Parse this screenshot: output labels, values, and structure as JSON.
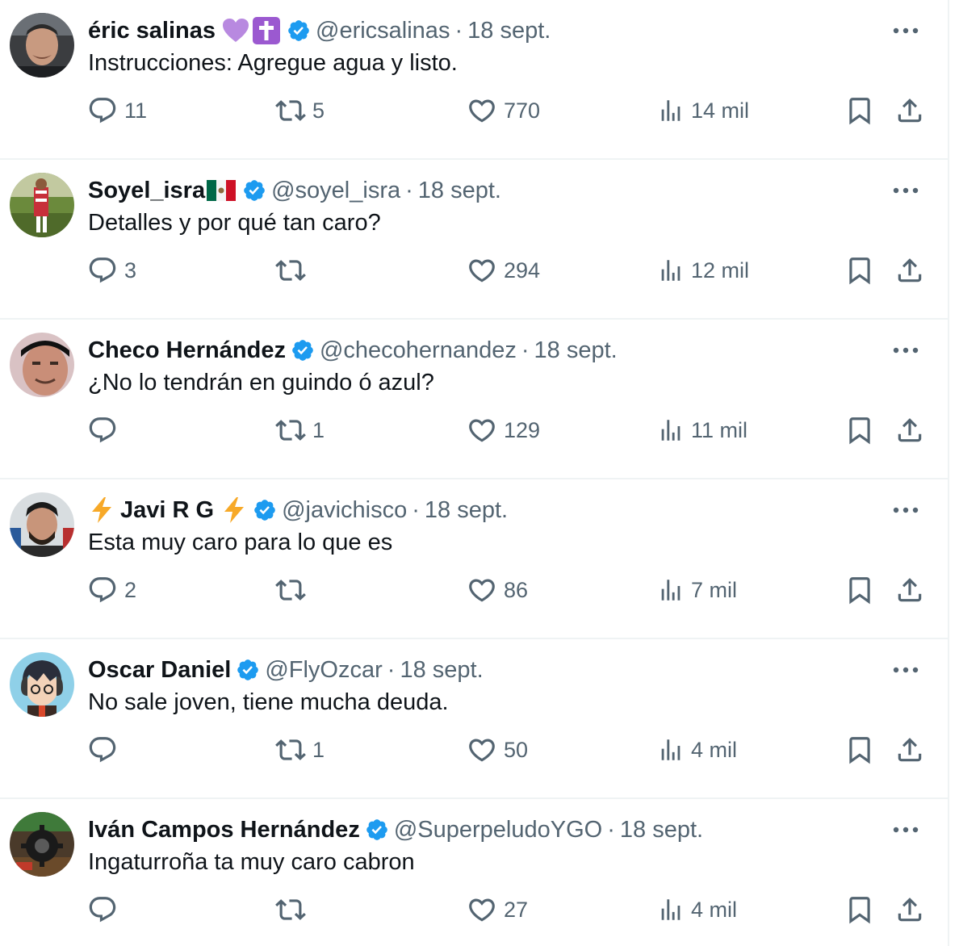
{
  "colors": {
    "text": "#0f1419",
    "secondary": "#536471",
    "verified": "#1d9bf0",
    "divider": "#eff3f4"
  },
  "tweets": [
    {
      "name": "éric salinas",
      "name_emojis": [
        "purple-heart-icon",
        "latin-cross-icon"
      ],
      "handle": "@ericsalinas",
      "separator": "·",
      "date": "18 sept.",
      "text": "Instrucciones: Agregue agua y listo.",
      "replies": "11",
      "retweets": "5",
      "likes": "770",
      "views": "14 mil"
    },
    {
      "name": "Soyel_isra",
      "name_emojis": [
        "mexico-flag-icon"
      ],
      "handle": "@soyel_isra",
      "separator": "·",
      "date": "18 sept.",
      "text": "Detalles y por qué tan caro?",
      "replies": "3",
      "retweets": "",
      "likes": "294",
      "views": "12 mil"
    },
    {
      "name": "Checo Hernández",
      "name_emojis": [],
      "handle": "@checohernandez",
      "separator": "·",
      "date": "18 sept.",
      "text": "¿No lo tendrán en guindo ó azul?",
      "replies": "",
      "retweets": "1",
      "likes": "129",
      "views": "11 mil"
    },
    {
      "name": "Javi R G",
      "name_emojis": [
        "lightning-icon"
      ],
      "handle": "@javichisco",
      "separator": "·",
      "date": "18 sept.",
      "text": "Esta muy caro para lo que es",
      "replies": "2",
      "retweets": "",
      "likes": "86",
      "views": "7 mil"
    },
    {
      "name": "Oscar Daniel",
      "name_emojis": [],
      "handle": "@FlyOzcar",
      "separator": "·",
      "date": "18 sept.",
      "text": "No sale joven, tiene mucha deuda.",
      "replies": "",
      "retweets": "1",
      "likes": "50",
      "views": "4 mil"
    },
    {
      "name": "Iván Campos Hernández",
      "name_emojis": [],
      "handle": "@SuperpeludoYGO",
      "separator": "·",
      "date": "18 sept.",
      "text": "Ingaturroña ta muy caro cabron",
      "replies": "",
      "retweets": "",
      "likes": "27",
      "views": "4 mil"
    }
  ]
}
